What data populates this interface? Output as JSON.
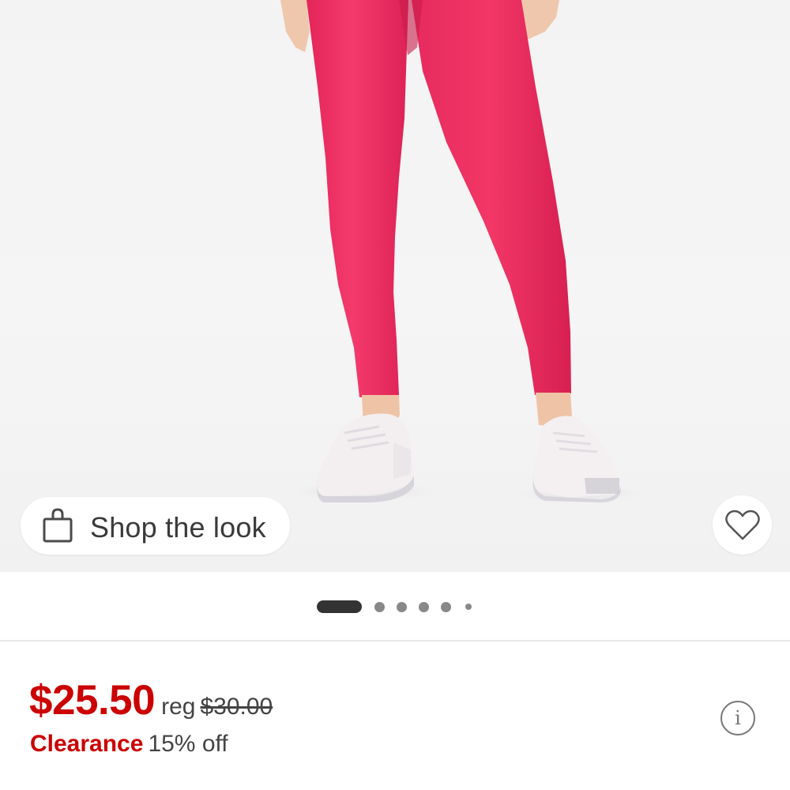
{
  "product_image": {
    "alt": "Pink high-rise leggings worn with white sneakers",
    "colors": {
      "leggings": "#ef2d62",
      "skin": "#efc3a6",
      "sneaker": "#f3eff0",
      "background": "#f4f4f4"
    }
  },
  "shop_the_look": {
    "label": "Shop the look",
    "icon": "shopping-bag-icon"
  },
  "favorite": {
    "icon": "heart-outline-icon"
  },
  "carousel": {
    "total": 6,
    "active_index": 0
  },
  "pricing": {
    "sale_price": "$25.50",
    "reg_label": "reg",
    "reg_price": "$30.00",
    "promo_tag": "Clearance",
    "promo_discount": "15% off",
    "info_icon": "info-icon",
    "info_symbol": "i",
    "colors": {
      "sale": "#cc0000",
      "text": "#444444"
    }
  }
}
